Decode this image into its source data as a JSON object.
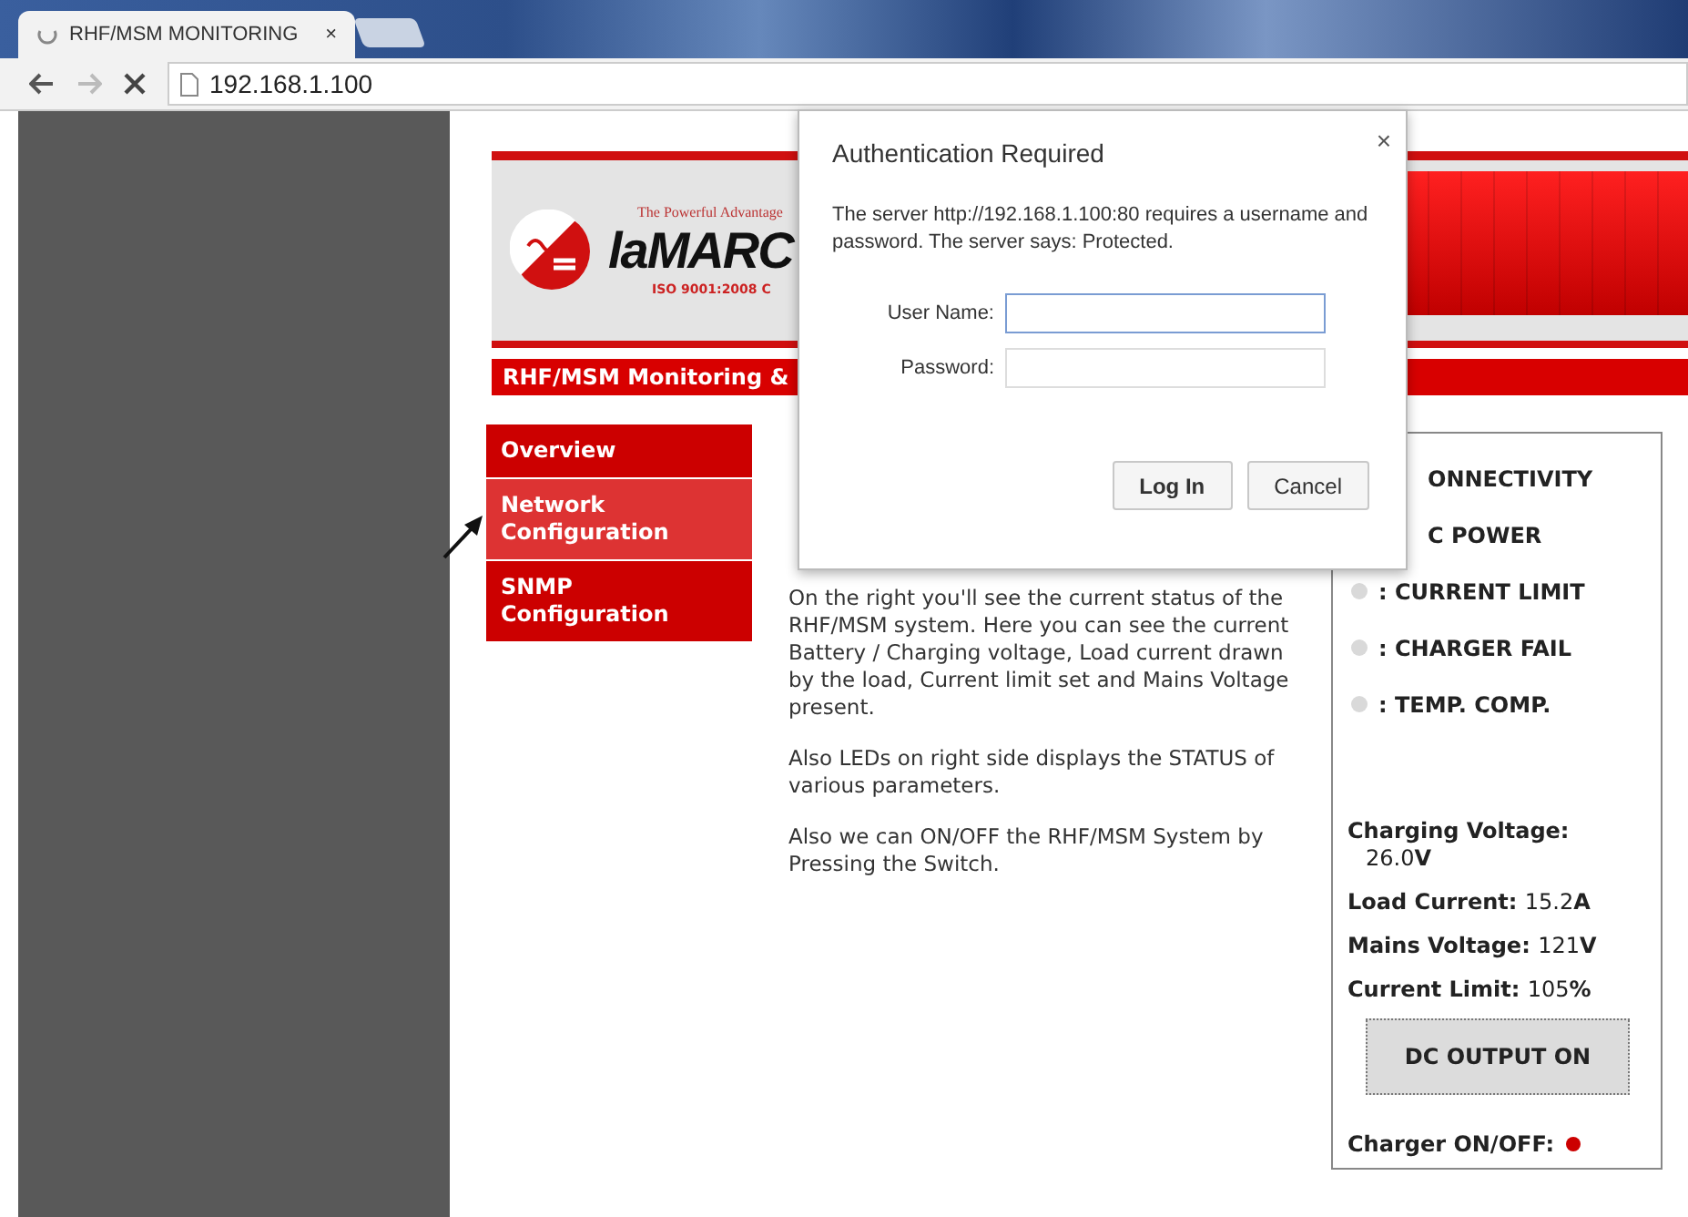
{
  "browser": {
    "tab": {
      "title": "RHF/MSM MONITORING",
      "close": "×",
      "loading": true
    },
    "address": "192.168.1.100",
    "forward_disabled": true
  },
  "logo": {
    "tagline": "The Powerful Advantage",
    "name": "laMARC",
    "certification": "ISO 9001:2008 C"
  },
  "header_bar": "RHF/MSM Monitoring &",
  "menu": [
    {
      "label": "Overview",
      "selected": false
    },
    {
      "label": "Network Configuration",
      "selected": true
    },
    {
      "label": "SNMP Configuration",
      "selected": false
    }
  ],
  "intro": {
    "paragraphs": [
      "On the right you'll see the current status of the RHF/MSM system. Here you can see the current Battery / Charging voltage, Load current drawn by the load, Current limit set and Mains Voltage present.",
      "Also LEDs on right side displays the STATUS of various parameters.",
      "Also we can ON/OFF the RHF/MSM System by Pressing the Switch."
    ]
  },
  "status": {
    "indicators": [
      {
        "kind": "covered",
        "label": "ONNECTIVITY"
      },
      {
        "kind": "covered",
        "label": "C POWER"
      },
      {
        "kind": "led",
        "label": ": CURRENT LIMIT",
        "color": "#d9d9d9"
      },
      {
        "kind": "led",
        "label": ": CHARGER FAIL",
        "color": "#d9d9d9"
      },
      {
        "kind": "led",
        "label": ": TEMP. COMP.",
        "color": "#d9d9d9"
      }
    ],
    "readings": [
      {
        "label": "Charging Voltage:",
        "value": "26.0",
        "unit": "V",
        "wrap": true
      },
      {
        "label": "Load Current:",
        "value": "15.2",
        "unit": "A",
        "wrap": false
      },
      {
        "label": "Mains Voltage:",
        "value": "121",
        "unit": "V",
        "wrap": false
      },
      {
        "label": "Current Limit:",
        "value": "105",
        "unit": "%",
        "wrap": false
      }
    ],
    "button": "DC OUTPUT ON",
    "charger": {
      "label": "Charger ON/OFF:",
      "color": "#cc0000"
    }
  },
  "dialog": {
    "title": "Authentication Required",
    "close": "×",
    "message": "The server http://192.168.1.100:80 requires a username and password. The server says: Protected.",
    "fields": [
      {
        "label": "User Name:",
        "focused": true
      },
      {
        "label": "Password:",
        "focused": false
      }
    ],
    "buttons": [
      "Log In",
      "Cancel"
    ]
  }
}
